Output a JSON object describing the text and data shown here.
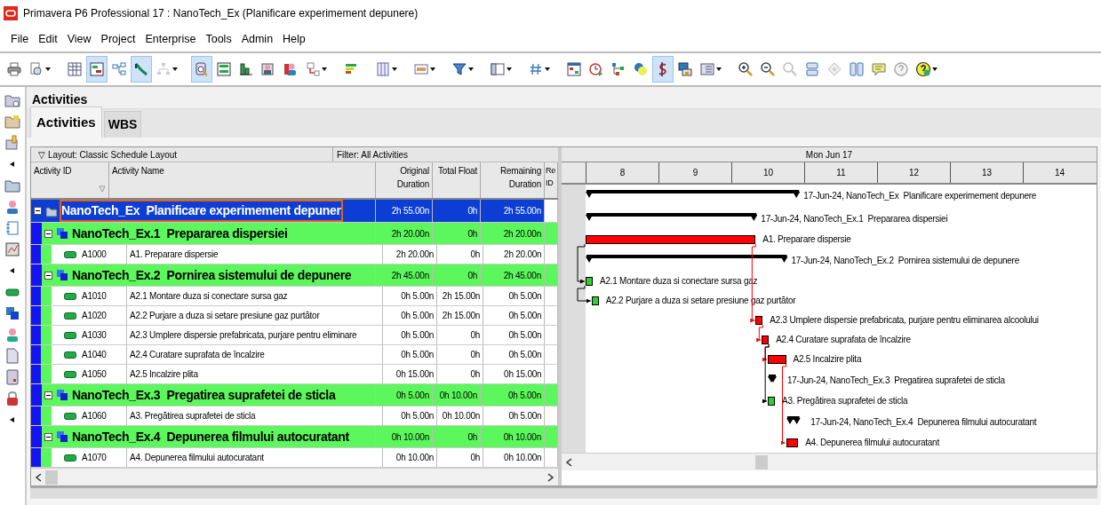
{
  "window": {
    "title": "Primavera P6 Professional 17 : NanoTech_Ex (Planificare experimement depunere)"
  },
  "menu": [
    "File",
    "Edit",
    "View",
    "Project",
    "Enterprise",
    "Tools",
    "Admin",
    "Help"
  ],
  "toolbar": [
    {
      "pressed": false
    },
    {
      "pressed": false
    },
    {
      "pressed": false
    },
    {
      "pressed": true
    },
    {
      "pressed": false
    },
    {
      "pressed": true
    },
    {
      "pressed": false
    },
    {
      "pressed": true
    },
    {
      "pressed": false
    },
    {
      "pressed": false
    },
    {
      "pressed": false
    },
    {
      "pressed": false
    },
    {
      "pressed": false
    },
    {
      "pressed": false
    },
    {
      "pressed": false
    },
    {
      "pressed": false
    },
    {
      "pressed": false
    },
    {
      "pressed": false
    },
    {
      "pressed": false
    },
    {
      "pressed": false
    },
    {
      "pressed": false
    },
    {
      "pressed": false
    },
    {
      "pressed": false
    },
    {
      "pressed": true
    },
    {
      "pressed": false
    },
    {
      "pressed": false
    },
    {
      "pressed": false
    },
    {
      "pressed": false
    },
    {
      "pressed": false
    },
    {
      "pressed": false
    },
    {
      "pressed": false
    },
    {
      "pressed": false
    },
    {
      "pressed": false
    },
    {
      "pressed": false
    },
    {
      "pressed": false
    }
  ],
  "workspace_title": "Activities",
  "tabs": [
    {
      "label": "Activities",
      "selected": true
    },
    {
      "label": "WBS",
      "selected": false
    }
  ],
  "layout_bar": {
    "toggle": "▽",
    "layout": "Layout: Classic Schedule Layout",
    "filter": "Filter: All Activities"
  },
  "table": {
    "columns": [
      "Activity ID",
      "Activity Name",
      "Original Duration",
      "Total Float",
      "Remaining Duration",
      "Re ID"
    ],
    "rows": [
      {
        "kind": "project",
        "expanded": true,
        "selected": true,
        "name": "NanoTech_Ex  Planificare experimement depuner",
        "original_duration": "2h 55.00n",
        "total_float": "0h",
        "remaining_duration": "2h 55.00n",
        "bar_label": "17-Jun-24, NanoTech_Ex  Planificare experimement depunere",
        "children": [
          {
            "kind": "wbs",
            "expanded": true,
            "selected": false,
            "name": "NanoTech_Ex.1  Prepararea dispersiei",
            "original_duration": "2h 20.00n",
            "total_float": "0h",
            "remaining_duration": "2h 20.00n",
            "bar_label": "17-Jun-24, NanoTech_Ex.1  Prepararea dispersiei",
            "children": [
              {
                "kind": "activity",
                "selected": false,
                "critical": true,
                "id": "A1000",
                "name": "A1. Preparare dispersie",
                "original_duration": "2h 20.00n",
                "total_float": "0h",
                "remaining_duration": "2h 20.00n",
                "bar_label": "A1. Preparare dispersie"
              }
            ]
          },
          {
            "kind": "wbs",
            "expanded": true,
            "selected": false,
            "name": "NanoTech_Ex.2  Pornirea sistemului de depunere",
            "original_duration": "2h 45.00n",
            "total_float": "0h",
            "remaining_duration": "2h 45.00n",
            "bar_label": "17-Jun-24, NanoTech_Ex.2  Pornirea sistemului de depunere",
            "children": [
              {
                "kind": "activity",
                "selected": false,
                "critical": false,
                "id": "A1010",
                "name": "A2.1 Montare duza si conectare sursa gaz",
                "original_duration": "0h 5.00n",
                "total_float": "2h 15.00n",
                "remaining_duration": "0h 5.00n",
                "bar_label": "A2.1 Montare duza si conectare sursa gaz"
              },
              {
                "kind": "activity",
                "selected": false,
                "critical": false,
                "id": "A1020",
                "name": "A2.2 Purjare a duza si setare presiune gaz purtător",
                "original_duration": "0h 5.00n",
                "total_float": "2h 15.00n",
                "remaining_duration": "0h 5.00n",
                "bar_label": "A2.2 Purjare a duza si setare presiune gaz purtător"
              },
              {
                "kind": "activity",
                "selected": false,
                "critical": true,
                "id": "A1030",
                "name": "A2.3 Umplere dispersie prefabricata, purjare pentru eliminare",
                "original_duration": "0h 5.00n",
                "total_float": "0h",
                "remaining_duration": "0h 5.00n",
                "bar_label": "A2.3 Umplere dispersie prefabricata, purjare pentru eliminarea alcoolului"
              },
              {
                "kind": "activity",
                "selected": false,
                "critical": true,
                "id": "A1040",
                "name": "A2.4 Curatare suprafata de încalzire",
                "original_duration": "0h 5.00n",
                "total_float": "0h",
                "remaining_duration": "0h 5.00n",
                "bar_label": "A2.4 Curatare suprafata de încalzire"
              },
              {
                "kind": "activity",
                "selected": false,
                "critical": true,
                "id": "A1050",
                "name": "A2.5 Incalzire plita",
                "original_duration": "0h 15.00n",
                "total_float": "0h",
                "remaining_duration": "0h 15.00n",
                "bar_label": "A2.5 Incalzire plita"
              }
            ]
          },
          {
            "kind": "wbs",
            "expanded": true,
            "selected": false,
            "name": "NanoTech_Ex.3  Pregatirea suprafetei de sticla",
            "original_duration": "0h 5.00n",
            "total_float": "0h 10.00n",
            "remaining_duration": "0h 5.00n",
            "bar_label": "17-Jun-24, NanoTech_Ex.3  Pregatirea suprafetei de sticla",
            "children": [
              {
                "kind": "activity",
                "selected": false,
                "critical": false,
                "id": "A1060",
                "name": "A3. Pregătirea suprafetei de sticla",
                "original_duration": "0h 5.00n",
                "total_float": "0h 10.00n",
                "remaining_duration": "0h 5.00n",
                "bar_label": "A3. Pregătirea suprafetei de sticla"
              }
            ]
          },
          {
            "kind": "wbs",
            "expanded": true,
            "selected": false,
            "name": "NanoTech_Ex.4  Depunerea filmului autocuratant",
            "original_duration": "0h 10.00n",
            "total_float": "0h",
            "remaining_duration": "0h 10.00n",
            "bar_label": "17-Jun-24, NanoTech_Ex.4  Depunerea filmului autocuratant",
            "children": [
              {
                "kind": "activity",
                "selected": false,
                "critical": true,
                "id": "A1070",
                "name": "A4. Depunerea filmului autocuratant",
                "original_duration": "0h 10.00n",
                "total_float": "0h",
                "remaining_duration": "0h 10.00n",
                "bar_label": "A4. Depunerea filmului autocuratant"
              }
            ]
          }
        ]
      }
    ]
  },
  "gantt": {
    "day": "Mon Jun 17",
    "hours": [
      "8",
      "9",
      "10",
      "11",
      "12",
      "13",
      "14"
    ]
  }
}
